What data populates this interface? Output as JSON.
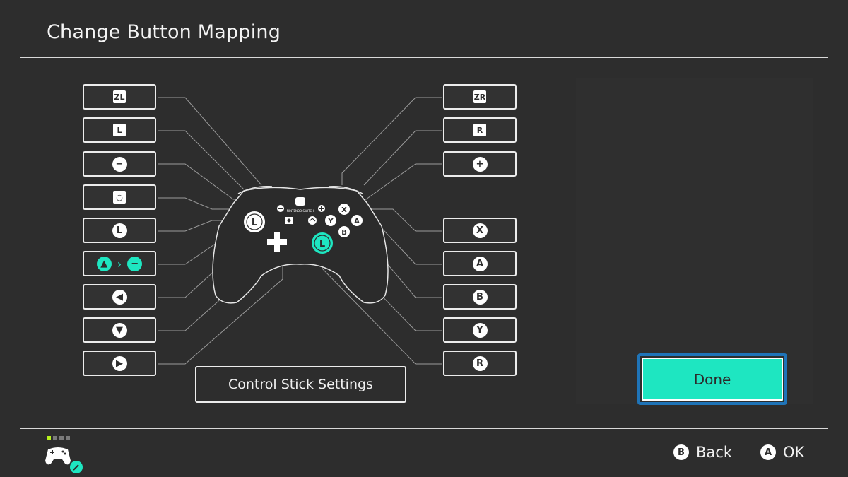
{
  "header": {
    "title": "Change Button Mapping"
  },
  "left_buttons": [
    {
      "name": "zl-mapping",
      "label": "ZL",
      "shape": "square"
    },
    {
      "name": "l-mapping",
      "label": "L",
      "shape": "square"
    },
    {
      "name": "minus-mapping",
      "label": "−",
      "shape": "circle"
    },
    {
      "name": "capture-mapping",
      "label": "○",
      "shape": "square"
    },
    {
      "name": "left-stick-press-mapping",
      "label": "L",
      "shape": "circle"
    },
    {
      "name": "dpad-up-mapping",
      "label": "▲",
      "remap_to": "−",
      "shape": "circle",
      "selected": true
    },
    {
      "name": "dpad-left-mapping",
      "label": "◀",
      "shape": "circle"
    },
    {
      "name": "dpad-down-mapping",
      "label": "▼",
      "shape": "circle"
    },
    {
      "name": "dpad-right-mapping",
      "label": "▶",
      "shape": "circle"
    }
  ],
  "right_buttons": [
    {
      "name": "zr-mapping",
      "label": "ZR",
      "shape": "square"
    },
    {
      "name": "r-mapping",
      "label": "R",
      "shape": "square"
    },
    {
      "name": "plus-mapping",
      "label": "+",
      "shape": "circle"
    },
    {
      "name": "x-mapping",
      "label": "X",
      "shape": "circle"
    },
    {
      "name": "a-mapping",
      "label": "A",
      "shape": "circle"
    },
    {
      "name": "b-mapping",
      "label": "B",
      "shape": "circle"
    },
    {
      "name": "y-mapping",
      "label": "Y",
      "shape": "circle"
    },
    {
      "name": "right-stick-press-mapping",
      "label": "R",
      "shape": "circle"
    }
  ],
  "controller": {
    "logo": "NINTENDO SWITCH",
    "face": {
      "x": "X",
      "a": "A",
      "b": "B",
      "y": "Y"
    },
    "left_stick": "L",
    "right_stick": "L"
  },
  "stick_settings_label": "Control Stick Settings",
  "done_label": "Done",
  "footer": {
    "back": {
      "key": "B",
      "label": "Back"
    },
    "ok": {
      "key": "A",
      "label": "OK"
    }
  },
  "colors": {
    "accent": "#1ee6c1",
    "focus": "#1f74b8",
    "background": "#2d2d2d",
    "user_indicator": "#b7f21c"
  },
  "icons": {
    "controller": "pro-controller-wrench-icon"
  }
}
